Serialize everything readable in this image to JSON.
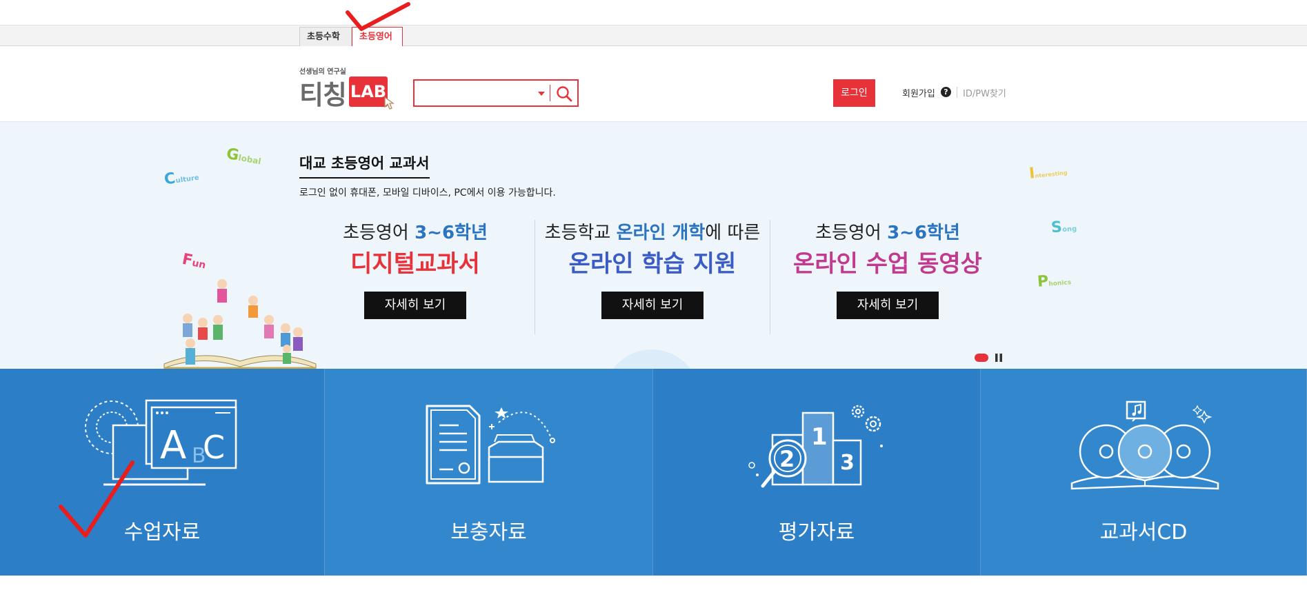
{
  "site_tabs": [
    {
      "label": "초등수학",
      "active": false
    },
    {
      "label": "초등영어",
      "active": true
    }
  ],
  "header": {
    "logo_sub": "선생님의 연구실",
    "logo_main": "티칭",
    "logo_lab": "LAB",
    "search_placeholder": "",
    "login_label": "로그인",
    "join_label": "회원가입",
    "help_label": "?",
    "find_label": "ID/PW찾기"
  },
  "banner": {
    "title": "대교 초등영어 교과서",
    "subtitle": "로그인 없이 휴대폰, 모바일 디바이스, PC에서 이용 가능합니다.",
    "deco": {
      "culture": {
        "cap": "C",
        "rest": "ulture"
      },
      "global": {
        "cap": "G",
        "rest": "lobal"
      },
      "fun": {
        "cap": "F",
        "rest": "un"
      },
      "song": {
        "cap": "S",
        "rest": "ong"
      },
      "phonics": {
        "cap": "P",
        "rest": "honics"
      },
      "interesting": {
        "cap": "I",
        "rest": "nteresting"
      }
    },
    "promos": [
      {
        "line1_a": "초등영어 ",
        "line1_b": "3~6학년",
        "line1_c": "",
        "line2": "디지털교과서",
        "button": "자세히 보기",
        "line2_color": "#e8323a"
      },
      {
        "line1_a": "초등학교 ",
        "line1_b": "온라인 개학",
        "line1_c": "에 따른",
        "line2": "온라인 학습 지원",
        "button": "자세히 보기",
        "line2_color": "#3a5cc4"
      },
      {
        "line1_a": "초등영어 ",
        "line1_b": "3~6학년",
        "line1_c": "",
        "line2": "온라인 수업 동영상",
        "button": "자세히 보기",
        "line2_color": "#c13a8f"
      }
    ]
  },
  "tiles": [
    {
      "label": "수업자료"
    },
    {
      "label": "보충자료"
    },
    {
      "label": "평가자료"
    },
    {
      "label": "교과서CD"
    }
  ],
  "tile_icon_text": {
    "abc_a": "A",
    "abc_b": "B",
    "abc_c": "C",
    "rank1": "1",
    "rank2": "2",
    "rank3": "3"
  },
  "colors": {
    "accent_red": "#e8323a",
    "tile_blue": "#2c7ec6",
    "tile_blue_alt": "#3388cd"
  }
}
